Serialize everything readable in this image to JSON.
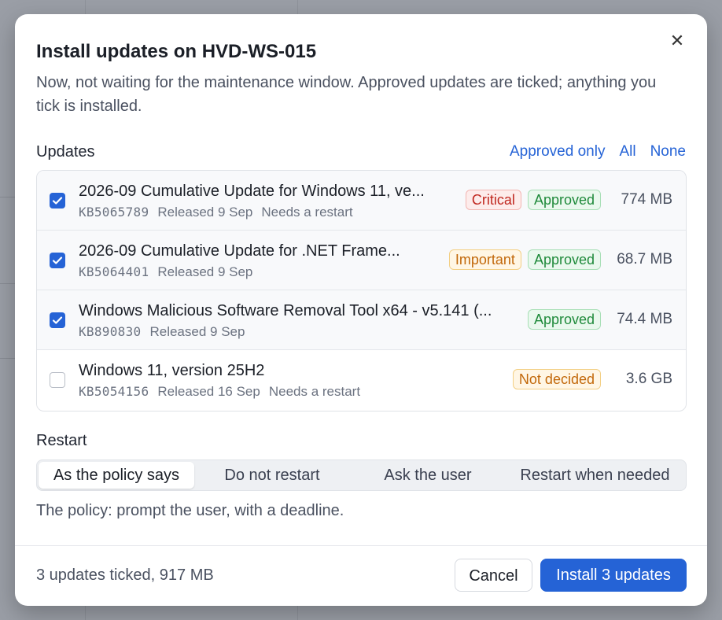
{
  "dialog": {
    "title": "Install updates on HVD-WS-015",
    "subtitle": "Now, not waiting for the maintenance window. Approved updates are ticked; anything you tick is installed.",
    "close_icon": "close-icon"
  },
  "updates": {
    "label": "Updates",
    "filters": [
      "Approved only",
      "All",
      "None"
    ],
    "items": [
      {
        "checked": true,
        "name": "2026-09 Cumulative Update for Windows 11, ve...",
        "kb": "KB5065789",
        "released": "Released 9 Sep",
        "note": "Needs a restart",
        "badges": [
          {
            "label": "Critical",
            "kind": "critical"
          },
          {
            "label": "Approved",
            "kind": "approved"
          }
        ],
        "size": "774 MB"
      },
      {
        "checked": true,
        "name": "2026-09 Cumulative Update for .NET Frame...",
        "kb": "KB5064401",
        "released": "Released 9 Sep",
        "note": "",
        "badges": [
          {
            "label": "Important",
            "kind": "important"
          },
          {
            "label": "Approved",
            "kind": "approved"
          }
        ],
        "size": "68.7 MB"
      },
      {
        "checked": true,
        "name": "Windows Malicious Software Removal Tool x64 - v5.141 (...",
        "kb": "KB890830",
        "released": "Released 9 Sep",
        "note": "",
        "badges": [
          {
            "label": "Approved",
            "kind": "approved"
          }
        ],
        "size": "74.4 MB"
      },
      {
        "checked": false,
        "name": "Windows 11, version 25H2",
        "kb": "KB5054156",
        "released": "Released 16 Sep",
        "note": "Needs a restart",
        "badges": [
          {
            "label": "Not decided",
            "kind": "notdecided"
          }
        ],
        "size": "3.6 GB"
      }
    ]
  },
  "restart": {
    "label": "Restart",
    "options": [
      "As the policy says",
      "Do not restart",
      "Ask the user",
      "Restart when needed"
    ],
    "selected": "As the policy says",
    "policy_note": "The policy: prompt the user, with a deadline."
  },
  "footer": {
    "summary": "3 updates ticked, 917 MB",
    "cancel_label": "Cancel",
    "install_label": "Install 3 updates"
  },
  "colors": {
    "accent": "#2563d6",
    "critical": "#c0271f",
    "important": "#c2680a",
    "approved": "#1f8a3b"
  }
}
